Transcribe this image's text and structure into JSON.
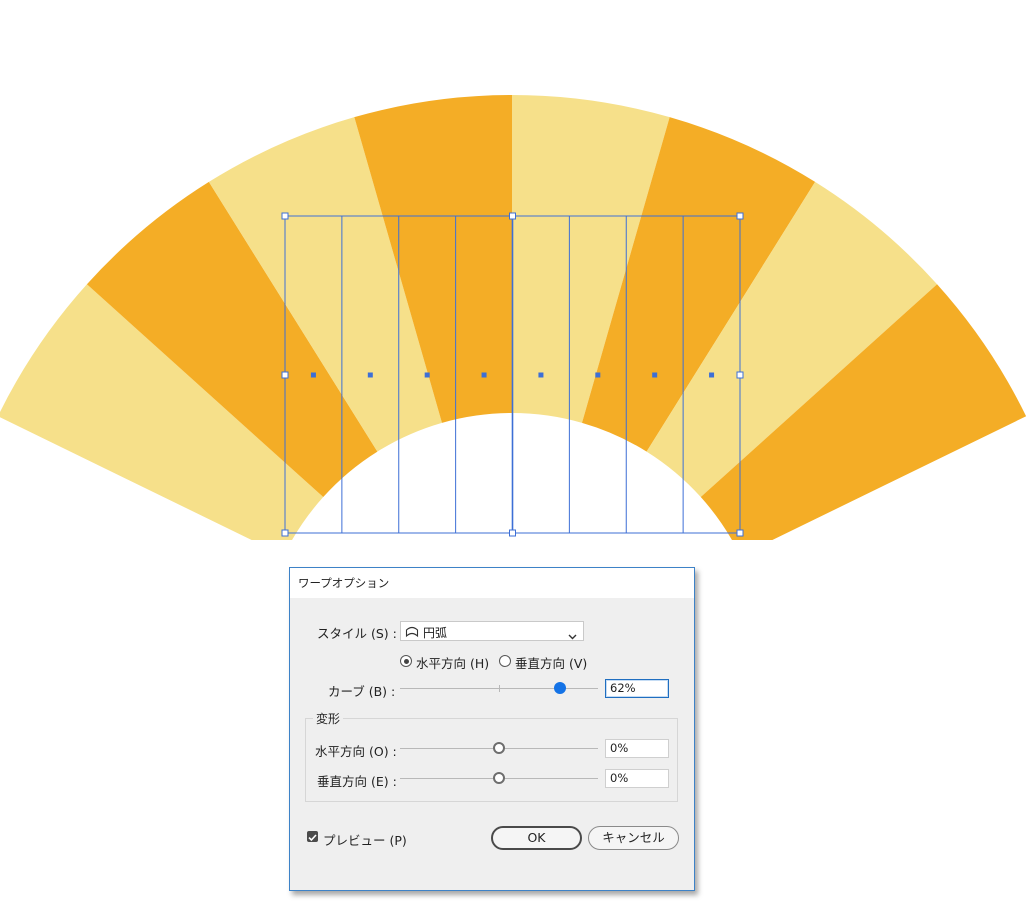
{
  "dialog": {
    "title": "ワープオプション",
    "style_label": "スタイル (S) :",
    "style_value": "円弧",
    "style_icon": "arc-icon",
    "orientation": {
      "horizontal_label": "水平方向 (H)",
      "vertical_label": "垂直方向 (V)",
      "selected": "horizontal"
    },
    "bend": {
      "label": "カーブ (B) :",
      "value": "62%",
      "level": 0.62
    },
    "distortion": {
      "group_label": "変形",
      "horizontal": {
        "label": "水平方向 (O) :",
        "value": "0%",
        "level": 0
      },
      "vertical": {
        "label": "垂直方向 (E) :",
        "value": "0%",
        "level": 0
      }
    },
    "preview": {
      "label": "プレビュー (P)",
      "checked": true
    },
    "ok_label": "OK",
    "cancel_label": "キャンセル"
  },
  "colors": {
    "stripe_dark": "#f4ad26",
    "stripe_light": "#f6e08a",
    "selection": "#3d6fd6",
    "accent": "#1473e6"
  }
}
